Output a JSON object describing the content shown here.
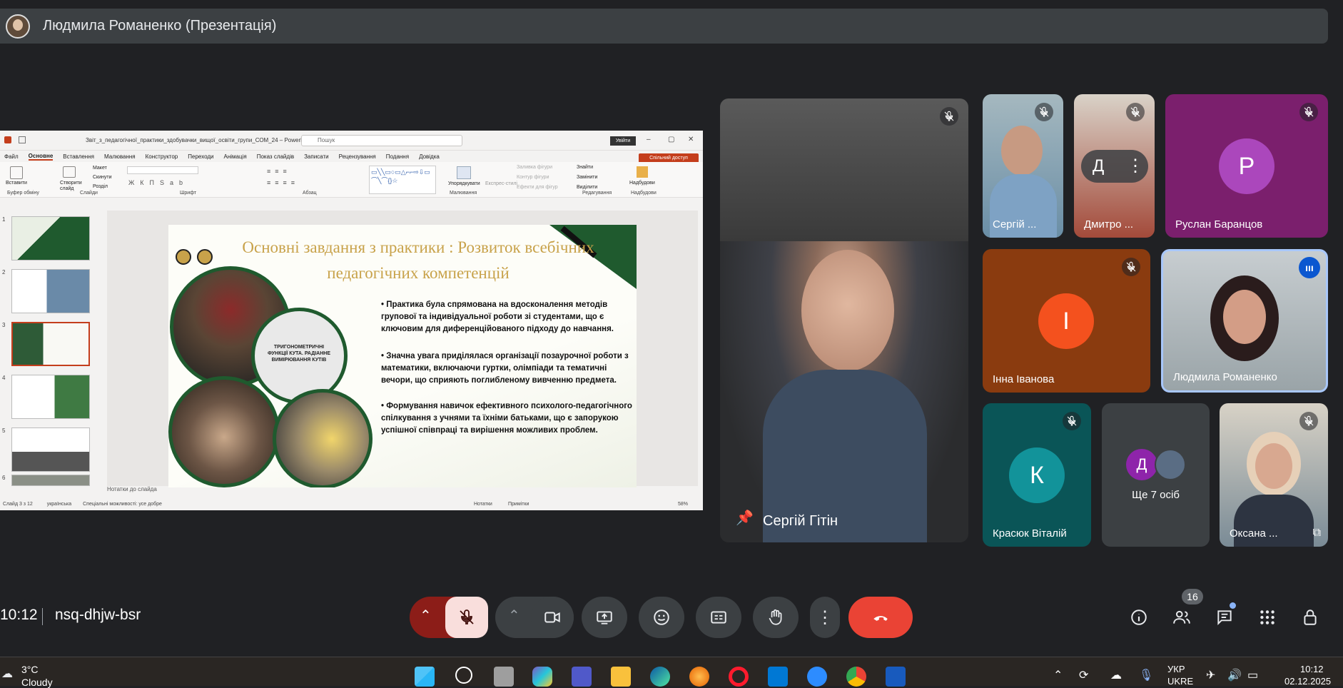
{
  "presenter": {
    "name": "Людмила Романенко (Презентація)"
  },
  "ppt": {
    "title": "Звіт_з_педагогічної_практики_здобувачки_вищої_освіти_групи_СОМ_24 – PowerP...",
    "search_placeholder": "Пошук",
    "signin": "Увійти",
    "tabs": [
      "Файл",
      "Основне",
      "Вставлення",
      "Малювання",
      "Конструктор",
      "Переходи",
      "Анімація",
      "Показ слайдів",
      "Записати",
      "Рецензування",
      "Подання",
      "Довідка"
    ],
    "share": "Спільний доступ",
    "ribbon_groups": [
      "Буфер обміну",
      "Слайди",
      "Шрифт",
      "Абзац",
      "Малювання",
      "Редагування",
      "Надбудови"
    ],
    "ribbon_labels": {
      "paste": "Вставити",
      "new_slide": "Створити слайд",
      "layout": "Макет",
      "reset": "Скинути",
      "section": "Розділ",
      "arrange": "Упорядкувати",
      "styles": "Експрес-стилі",
      "fill": "Заливка фігури",
      "outline": "Контур фігури",
      "effects": "Ефекти для фігур",
      "find": "Знайти",
      "replace": "Замінити",
      "select": "Виділити",
      "addins": "Надбудови"
    },
    "thumb_numbers": [
      "1",
      "2",
      "3",
      "4",
      "5",
      "6"
    ],
    "slide": {
      "title": "Основні завдання з практики : Розвиток всебічних педагогічних компетенцій",
      "photo_caption": "ТРИГОНОМЕТРИЧНІ ФУНКЦІЇ КУТА. РАДІАННЕ ВИМІРЮВАННЯ КУТІВ",
      "bullets": [
        "Практика була спрямована на вдосконалення методів групової та індивідуальної роботи зі студентами, що є ключовим для диференційованого підходу до навчання.",
        "Значна увага приділялася організації позаурочної роботи з математики, включаючи гуртки, олімпіади та тематичні вечори, що сприяють поглибленому вивченню предмета.",
        "Формування навичок ефективного психолого-педагогічного спілкування з учнями та їхніми батьками, що є запорукою успішної співпраці та вирішення можливих проблем."
      ]
    },
    "notes_placeholder": "Нотатки до слайда",
    "status": {
      "slide": "Слайд 3 з 12",
      "lang": "українська",
      "accessibility": "Спеціальні можливості: усе добре",
      "notes": "Нотатки",
      "comments": "Примітки",
      "zoom": "58%"
    }
  },
  "participants": {
    "pinned": {
      "name": "Сергій Гітін"
    },
    "serhii": {
      "name": "Сергій ..."
    },
    "dmytro": {
      "name": "Дмитро ...",
      "letter": "Д"
    },
    "ruslan": {
      "name": "Руслан Баранцов",
      "letter": "Р",
      "color": "#8e24aa"
    },
    "inna": {
      "name": "Інна Іванова",
      "letter": "І",
      "color": "#f4511e"
    },
    "liudmyla": {
      "name": "Людмила Романенко"
    },
    "krasiuk": {
      "name": "Красюк Віталій",
      "letter": "К",
      "color": "#0e8a8a"
    },
    "more": {
      "label": "Ще 7 осіб",
      "letter": "Д"
    },
    "oksana": {
      "name": "Оксана ..."
    }
  },
  "meeting": {
    "time": "10:12",
    "code": "nsq-dhjw-bsr",
    "people_count": "16"
  },
  "taskbar": {
    "temp": "3°C",
    "weather": "Cloudy",
    "lang": "УКР",
    "lang2": "UKRE",
    "clock": "10:12",
    "date": "02.12.2025"
  },
  "colors": {
    "end_call": "#ea4335",
    "mic_off_bg": "#f9dedc",
    "bg": "#202124"
  }
}
